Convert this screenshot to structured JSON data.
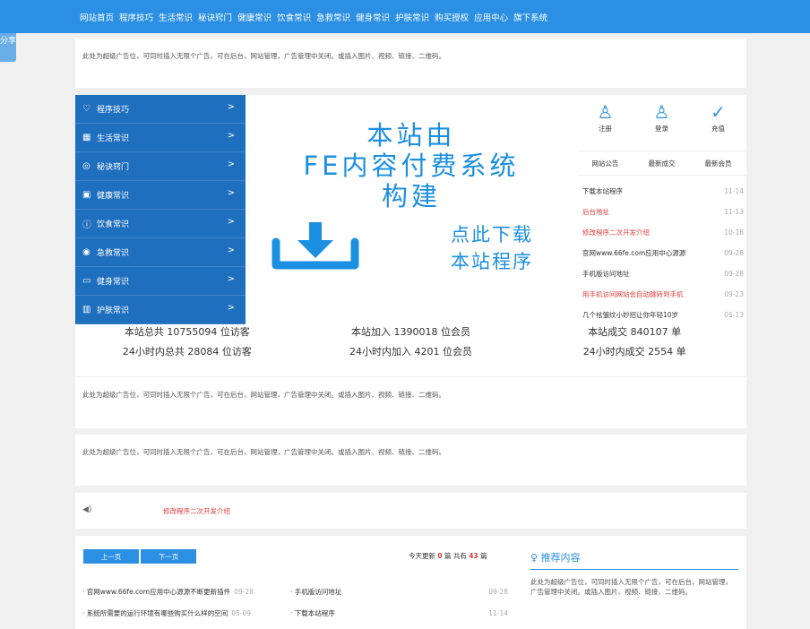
{
  "nav": {
    "items": [
      "网站首页",
      "程序技巧",
      "生活常识",
      "秘诀窍门",
      "健康常识",
      "饮食常识",
      "急救常识",
      "健身常识",
      "护肤常识",
      "购买授权",
      "应用中心",
      "旗下系统"
    ]
  },
  "share_label": "分享",
  "ad_text": "此处为超级广告位，可同时插入无限个广告，可在后台，网站管理，广告管理中关闭。或插入图片、视频、链接、二维码。",
  "side_menu": [
    {
      "icon": "diamond-icon",
      "glyph": "♡",
      "label": "程序技巧"
    },
    {
      "icon": "grid-icon",
      "glyph": "▦",
      "label": "生活常识"
    },
    {
      "icon": "check-circle-icon",
      "glyph": "◎",
      "label": "秘诀窍门"
    },
    {
      "icon": "image-icon",
      "glyph": "▣",
      "label": "健康常识"
    },
    {
      "icon": "info-icon",
      "glyph": "ⓘ",
      "label": "饮食常识"
    },
    {
      "icon": "chat-icon",
      "glyph": "◉",
      "label": "急救常识"
    },
    {
      "icon": "folder-icon",
      "glyph": "▭",
      "label": "健身常识"
    },
    {
      "icon": "columns-icon",
      "glyph": "▥",
      "label": "护肤常识"
    }
  ],
  "banner": {
    "line1": "本站由",
    "line2": "FE内容付费系统",
    "line3": "构建",
    "cta1": "点此下载",
    "cta2": "本站程序"
  },
  "stats": {
    "row1": [
      "本站总共 10755094 位访客",
      "本站加入 1390018 位会员",
      "本站成交 840107 单"
    ],
    "row2": [
      "24小时内总共 28084 位访客",
      "24小时内加入 4201 位会员",
      "24小时内成交 2554 单"
    ]
  },
  "user_icons": [
    {
      "label": "注册",
      "glyph": "♙",
      "icon": "user-add-icon"
    },
    {
      "label": "登录",
      "glyph": "♙",
      "icon": "user-icon"
    },
    {
      "label": "充值",
      "glyph": "✓",
      "icon": "badge-check-icon"
    }
  ],
  "tabs": [
    "网站公告",
    "最新成交",
    "最新会员"
  ],
  "announcements": [
    {
      "title": "下载本站程序",
      "date": "11-14",
      "red": false
    },
    {
      "title": "后台地址",
      "date": "11-13",
      "red": true
    },
    {
      "title": "修改程序二次开发介绍",
      "date": "10-18",
      "red": true
    },
    {
      "title": "官网www.66fe.com应用中心源源",
      "date": "09-28",
      "red": false
    },
    {
      "title": "手机版访问地址",
      "date": "09-28",
      "red": false
    },
    {
      "title": "用手机访问网站会自动跳转到手机",
      "date": "09-23",
      "red": true
    },
    {
      "title": "几个祛皱纹小妙招让你年轻10岁",
      "date": "05-13",
      "red": false
    }
  ],
  "notice_text": "修改程序二次开发介绍",
  "pager": {
    "prev": "上一页",
    "next": "下一页"
  },
  "update": {
    "prefix": "今天更新",
    "today": "0",
    "mid": "篇 共有",
    "total": "43",
    "suffix": "篇"
  },
  "bottom_list": [
    {
      "a": "官网www.66fe.com应用中心源源不断更新插件",
      "ad": "09-28",
      "b": "手机版访问地址",
      "bd": "09-28"
    },
    {
      "a": "系统所需要的运行环境有哪些购买什么样的空间",
      "ad": "05-09",
      "b": "下载本站程序",
      "bd": "11-14"
    }
  ],
  "recommend": {
    "title": "推荐内容",
    "text": "此处为超级广告位，可同时插入无限个广告，可在后台，网站管理，广告管理中关闭。或插入图片、视频、链接、二维码。"
  }
}
